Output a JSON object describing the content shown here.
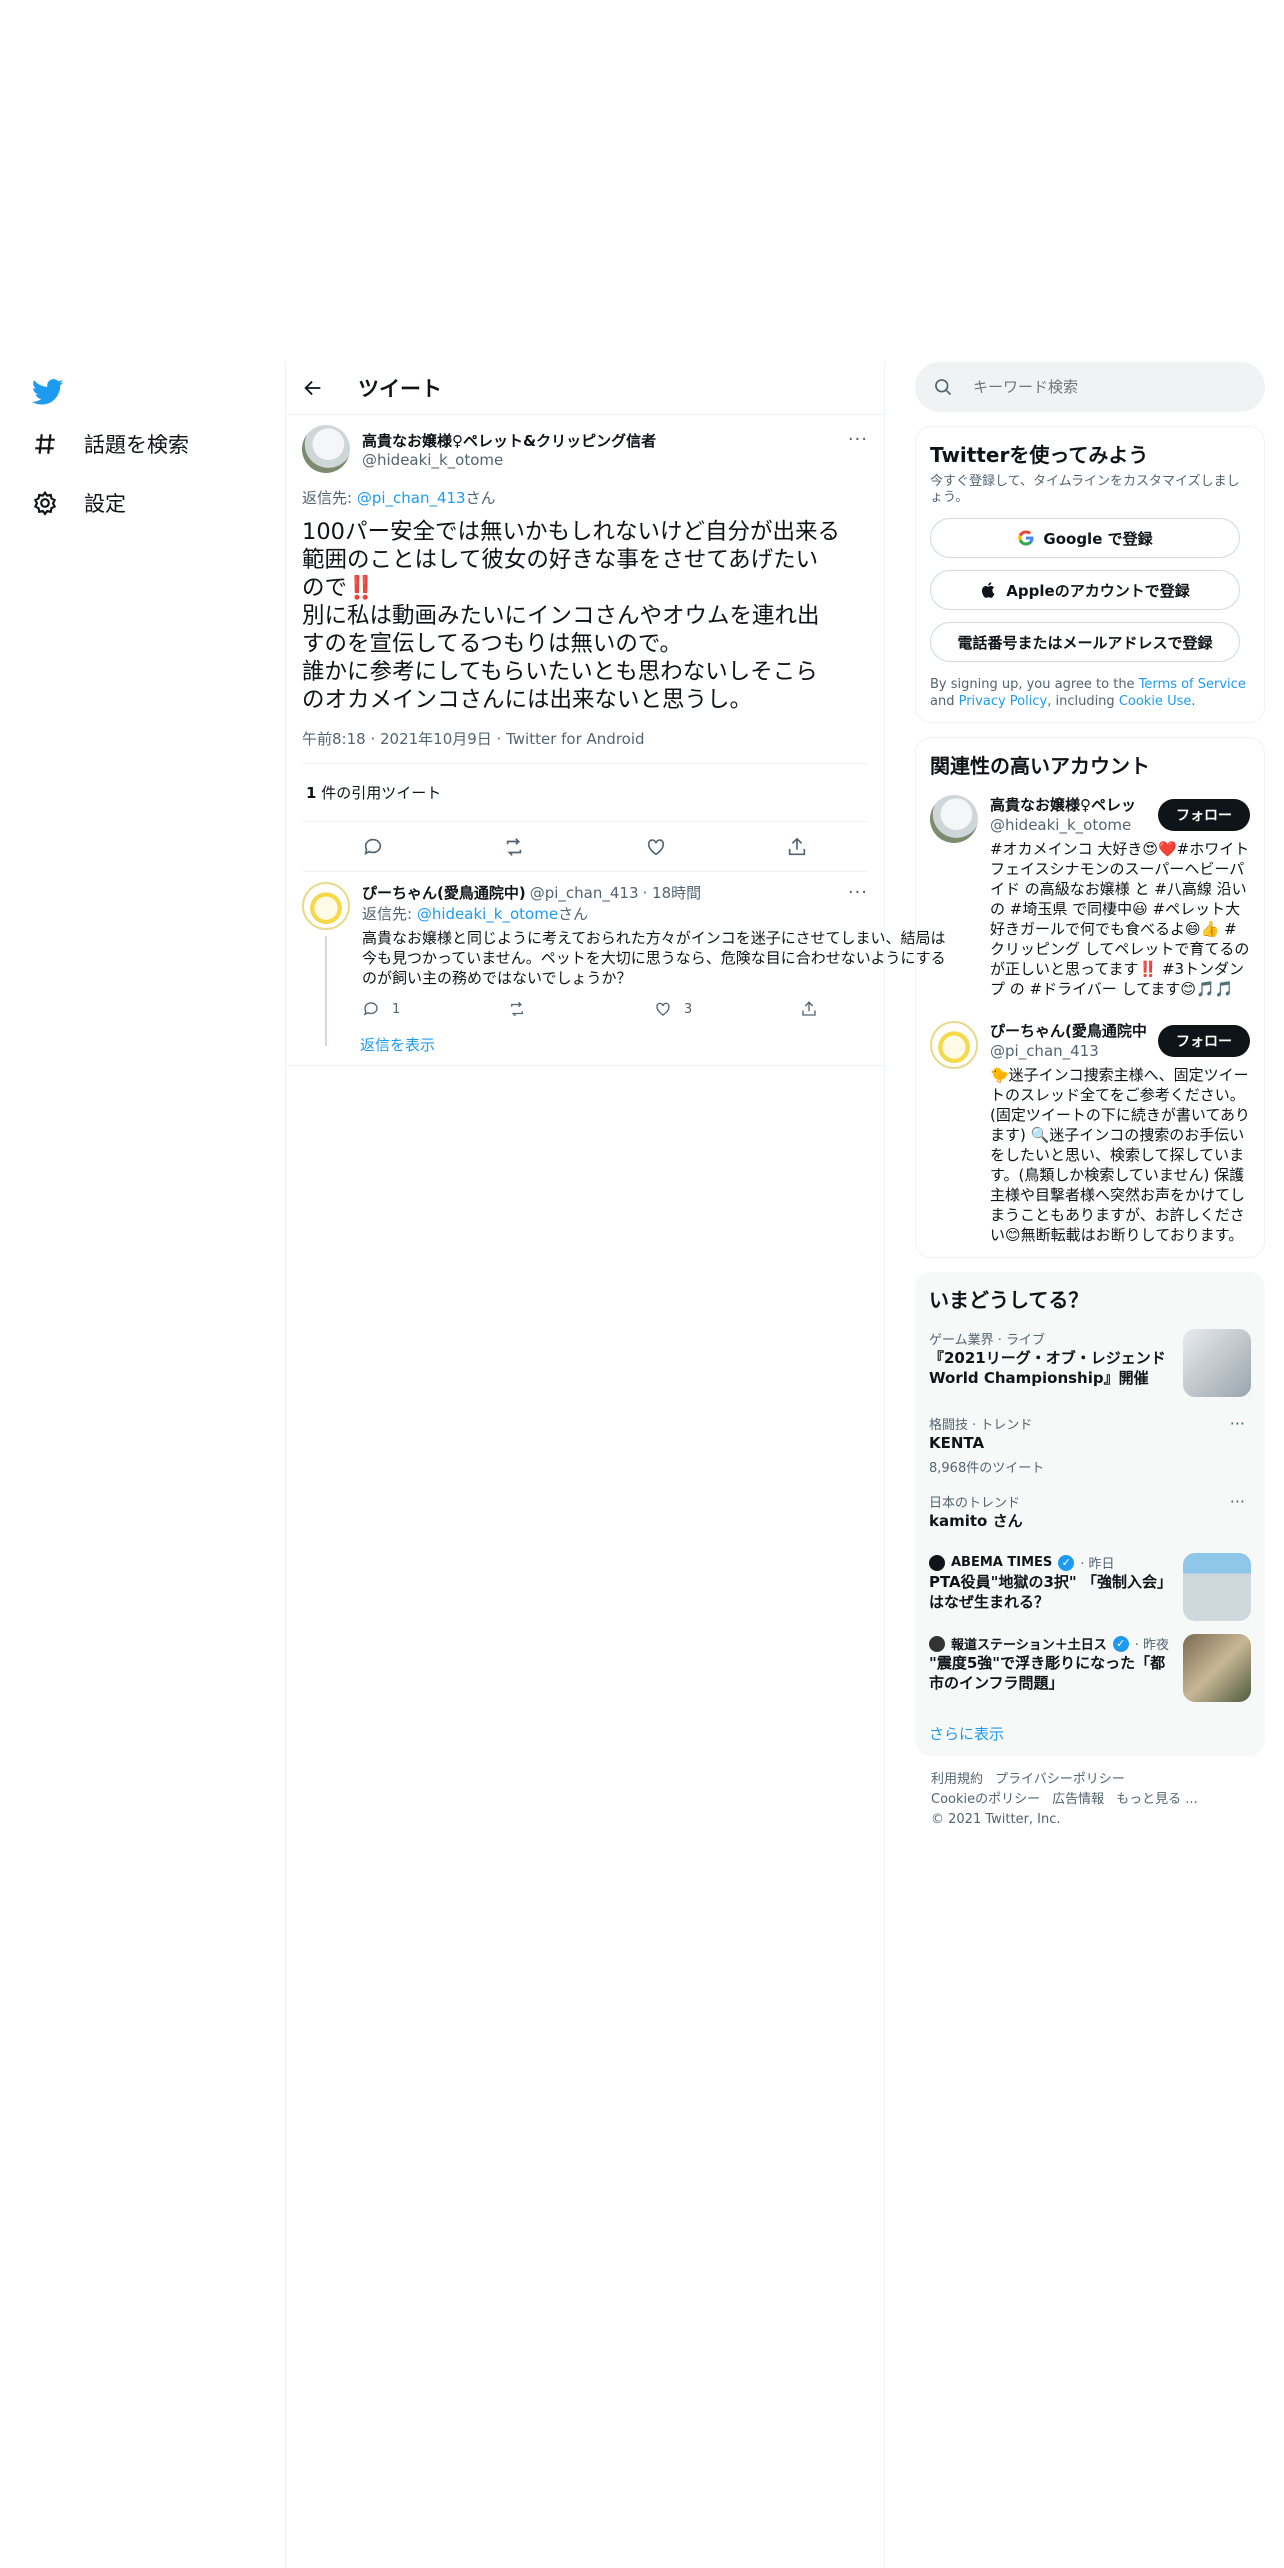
{
  "colors": {
    "accent": "#1d9bf0",
    "text": "#0f1419",
    "muted": "#536471",
    "border": "#eff3f4"
  },
  "nav": {
    "logo_icon": "twitter-bird-icon",
    "items": [
      {
        "label": "話題を検索",
        "icon": "hashtag-icon"
      },
      {
        "label": "設定",
        "icon": "gear-icon"
      }
    ]
  },
  "header": {
    "title": "ツイート"
  },
  "main_tweet": {
    "name": "高貴なお嬢様♀ペレット&クリッピング信者",
    "handle": "@hideaki_k_otome",
    "more": "···",
    "reply_prefix": "返信先: ",
    "reply_handle": "@pi_chan_413",
    "reply_suffix": "さん",
    "text": "100パー安全では無いかもしれないけど自分が出来る\n範囲のことはして彼女の好きな事をさせてあげたい\nので‼️\n別に私は動画みたいにインコさんやオウムを連れ出\nすのを宣伝してるつもりは無いので。\n誰かに参考にしてもらいたいとも思わないしそこら\nのオカメインコさんには出来ないと思うし。",
    "meta": "午前8:18 · 2021年10月9日 · Twitter for Android",
    "quote_count": "1",
    "quote_label": " 件の引用ツイート"
  },
  "reply": {
    "name": "ぴーちゃん(愛鳥通院中)",
    "handle": "@pi_chan_413",
    "time": "· 18時間",
    "more": "···",
    "reply_prefix": "返信先: ",
    "reply_handle": "@hideaki_k_otome",
    "reply_suffix": "さん",
    "text": "高貴なお嬢様と同じように考えておられた方々がインコを迷子にさせてしまい、結局は今も見つかっていません。ペットを大切に思うなら、危険な目に合わせないようにするのが飼い主の務めではないでしょうか？",
    "reply_count": "1",
    "retweet_count": "",
    "like_count": "3",
    "show_replies": "返信を表示"
  },
  "search": {
    "placeholder": "キーワード検索"
  },
  "signup": {
    "title": "Twitterを使ってみよう",
    "subtitle": "今すぐ登録して、タイムラインをカスタマイズしましょう。",
    "google": "Google で登録",
    "apple": "Appleのアカウントで登録",
    "phone": "電話番号またはメールアドレスで登録",
    "legal_1": "By signing up, you agree to the ",
    "terms": "Terms of Service",
    "legal_2": " and ",
    "privacy": "Privacy Policy",
    "legal_3": ", including ",
    "cookie": "Cookie Use",
    "legal_4": "."
  },
  "related": {
    "title": "関連性の高いアカウント",
    "accounts": [
      {
        "name": "高貴なお嬢様♀ペレッ",
        "handle": "@hideaki_k_otome",
        "follow": "フォロー",
        "bio": "#オカメインコ 大好き😍❤️#ホワイトフェイスシナモンのスーパーヘビーパイド の高級なお嬢様 と #八高線 沿いの #埼玉県 で同棲中😃 #ペレット大好きガールで何でも食べるよ😄👍 #クリッピング してペレットで育てるのが正しいと思ってます‼️ #3トンダンプ の #ドライバー してます😊🎵🎵"
      },
      {
        "name": "ぴーちゃん(愛鳥通院中",
        "handle": "@pi_chan_413",
        "follow": "フォロー",
        "bio": "🐤迷子インコ捜索主様へ、固定ツイートのスレッド全てをご参考ください。(固定ツイートの下に続きが書いてあります) 🔍迷子インコの捜索のお手伝いをしたいと思い、検索して探しています。(鳥類しか検索していません) 保護主様や目撃者様へ突然お声をかけてしまうこともありますが、お許しください😊無断転載はお断りしております。"
      }
    ]
  },
  "trends": {
    "title": "いまどうしてる？",
    "items": [
      {
        "category": "ゲーム業界 · ライブ",
        "title": "『2021リーグ・オブ・レジェンド World Championship』開催",
        "count": "",
        "thumb": "trophy"
      },
      {
        "category": "格闘技 · トレンド",
        "title": "KENTA",
        "count": "8,968件のツイート",
        "thumb": ""
      },
      {
        "category": "日本のトレンド",
        "title": "kamito さん",
        "count": "",
        "thumb": ""
      },
      {
        "category": "ABEMA TIMES",
        "meta": "· 昨日",
        "title": "PTA役員\"地獄の3択\" 「強制入会」はなぜ生まれる？",
        "count": "",
        "thumb": "news"
      },
      {
        "category": "報道ステーション＋土日ス",
        "meta": "· 昨夜",
        "title": "\"震度5強\"で浮き彫りになった「都市のインフラ問題」",
        "count": "",
        "thumb": "news2"
      }
    ],
    "show_more": "さらに表示"
  },
  "footer": {
    "links": [
      "利用規約",
      "プライバシーポリシー",
      "Cookieのポリシー",
      "広告情報",
      "もっと見る ..."
    ],
    "copyright": "© 2021 Twitter, Inc."
  }
}
